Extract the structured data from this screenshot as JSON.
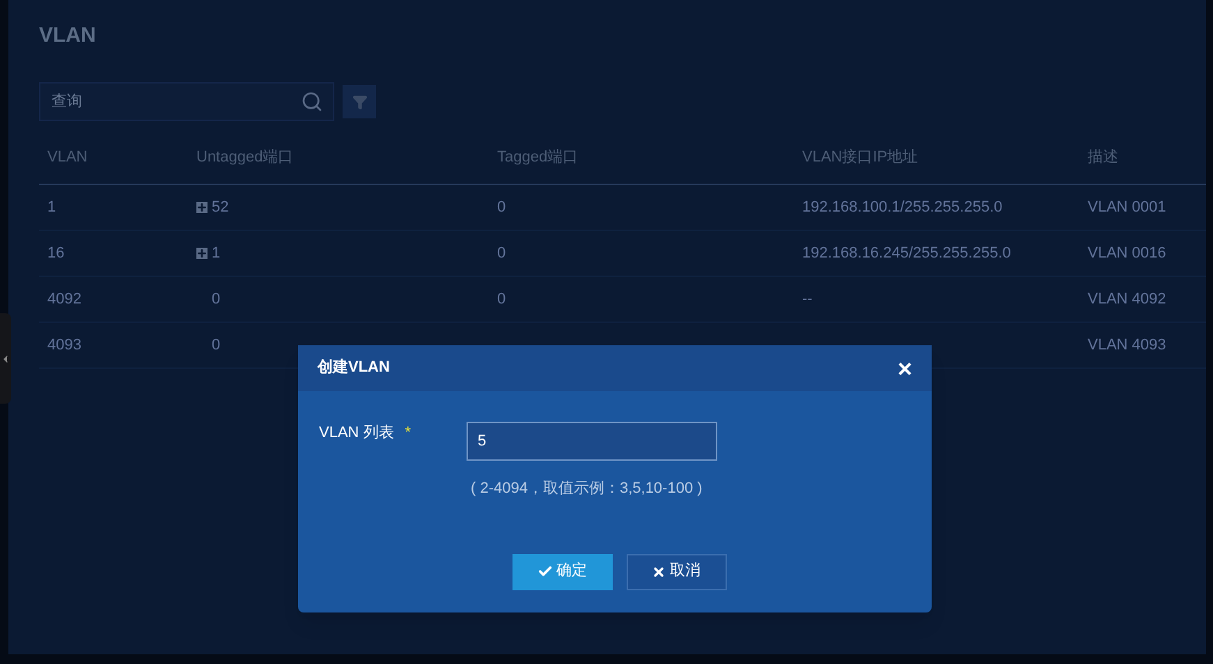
{
  "page": {
    "title": "VLAN"
  },
  "search": {
    "placeholder": "查询"
  },
  "table": {
    "columns": [
      "VLAN",
      "Untagged端口",
      "Tagged端口",
      "VLAN接口IP地址",
      "描述"
    ],
    "rows": [
      {
        "vlan": "1",
        "untagged": "52",
        "untagged_expandable": true,
        "tagged": "0",
        "ip": "192.168.100.1/255.255.255.0",
        "description": "VLAN 0001"
      },
      {
        "vlan": "16",
        "untagged": "1",
        "untagged_expandable": true,
        "tagged": "0",
        "ip": "192.168.16.245/255.255.255.0",
        "description": "VLAN 0016"
      },
      {
        "vlan": "4092",
        "untagged": "0",
        "untagged_expandable": false,
        "tagged": "0",
        "ip": "--",
        "description": "VLAN 4092"
      },
      {
        "vlan": "4093",
        "untagged": "0",
        "untagged_expandable": false,
        "description": "VLAN 4093"
      }
    ]
  },
  "dialog": {
    "title": "创建VLAN",
    "close": "×",
    "field_label": "VLAN 列表",
    "required_mark": "*",
    "field_value": "5",
    "hint": "( 2-4094，取值示例：3,5,10-100 )",
    "buttons": [
      {
        "label": "确定",
        "kind": "primary"
      },
      {
        "label": "取消",
        "kind": "secondary"
      }
    ]
  }
}
